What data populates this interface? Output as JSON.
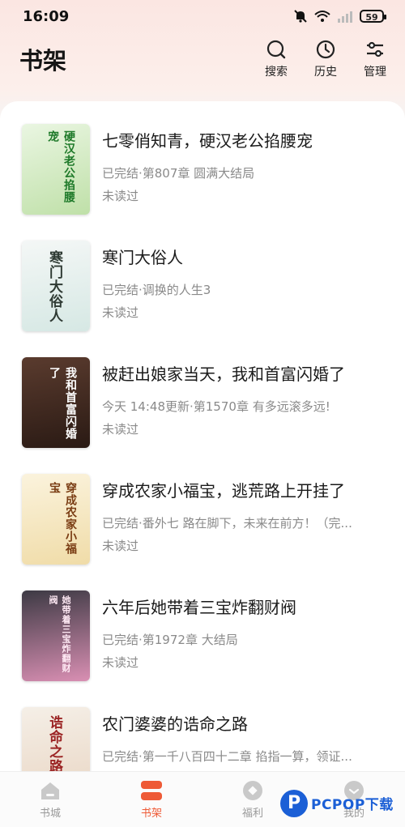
{
  "status_bar": {
    "time": "16:09",
    "battery": "59"
  },
  "header": {
    "title": "书架",
    "actions": [
      {
        "label": "搜索",
        "icon": "search-icon"
      },
      {
        "label": "历史",
        "icon": "history-clock-icon"
      },
      {
        "label": "管理",
        "icon": "manage-sliders-icon"
      }
    ]
  },
  "books": [
    {
      "title": "七零俏知青，硬汉老公掐腰宠",
      "status": "已完结·第807章 圆满大结局",
      "progress": "未读过",
      "cover_text": "硬汉老公掐腰宠"
    },
    {
      "title": "寒门大俗人",
      "status": "已完结·调换的人生3",
      "progress": "未读过",
      "cover_text": "寒门大俗人"
    },
    {
      "title": "被赶出娘家当天，我和首富闪婚了",
      "status": "今天 14:48更新·第1570章 有多远滚多远!",
      "progress": "未读过",
      "cover_text": "我和首富闪婚了"
    },
    {
      "title": "穿成农家小福宝，逃荒路上开挂了",
      "status": "已完结·番外七 路在脚下，未来在前方！（完...",
      "progress": "未读过",
      "cover_text": "穿成农家小福宝"
    },
    {
      "title": "六年后她带着三宝炸翻财阀",
      "status": "已完结·第1972章 大结局",
      "progress": "未读过",
      "cover_text": "她带着三宝炸翻财阀"
    },
    {
      "title": "农门婆婆的诰命之路",
      "status": "已完结·第一千八百四十二章 掐指一算，领证...",
      "progress": "",
      "cover_text": "诰命之路"
    }
  ],
  "tabs": [
    {
      "label": "书城",
      "icon": "bookstore-icon"
    },
    {
      "label": "书架",
      "icon": "bookshelf-icon",
      "active": true
    },
    {
      "label": "福利",
      "icon": "welfare-icon"
    },
    {
      "label": "我的",
      "icon": "profile-icon"
    }
  ],
  "watermark": {
    "logo": "P",
    "text": "PCPOP下载"
  },
  "colors": {
    "accent": "#ee5a36",
    "header_bg": "#fbe6e2",
    "muted_text": "#8a8a8a"
  }
}
